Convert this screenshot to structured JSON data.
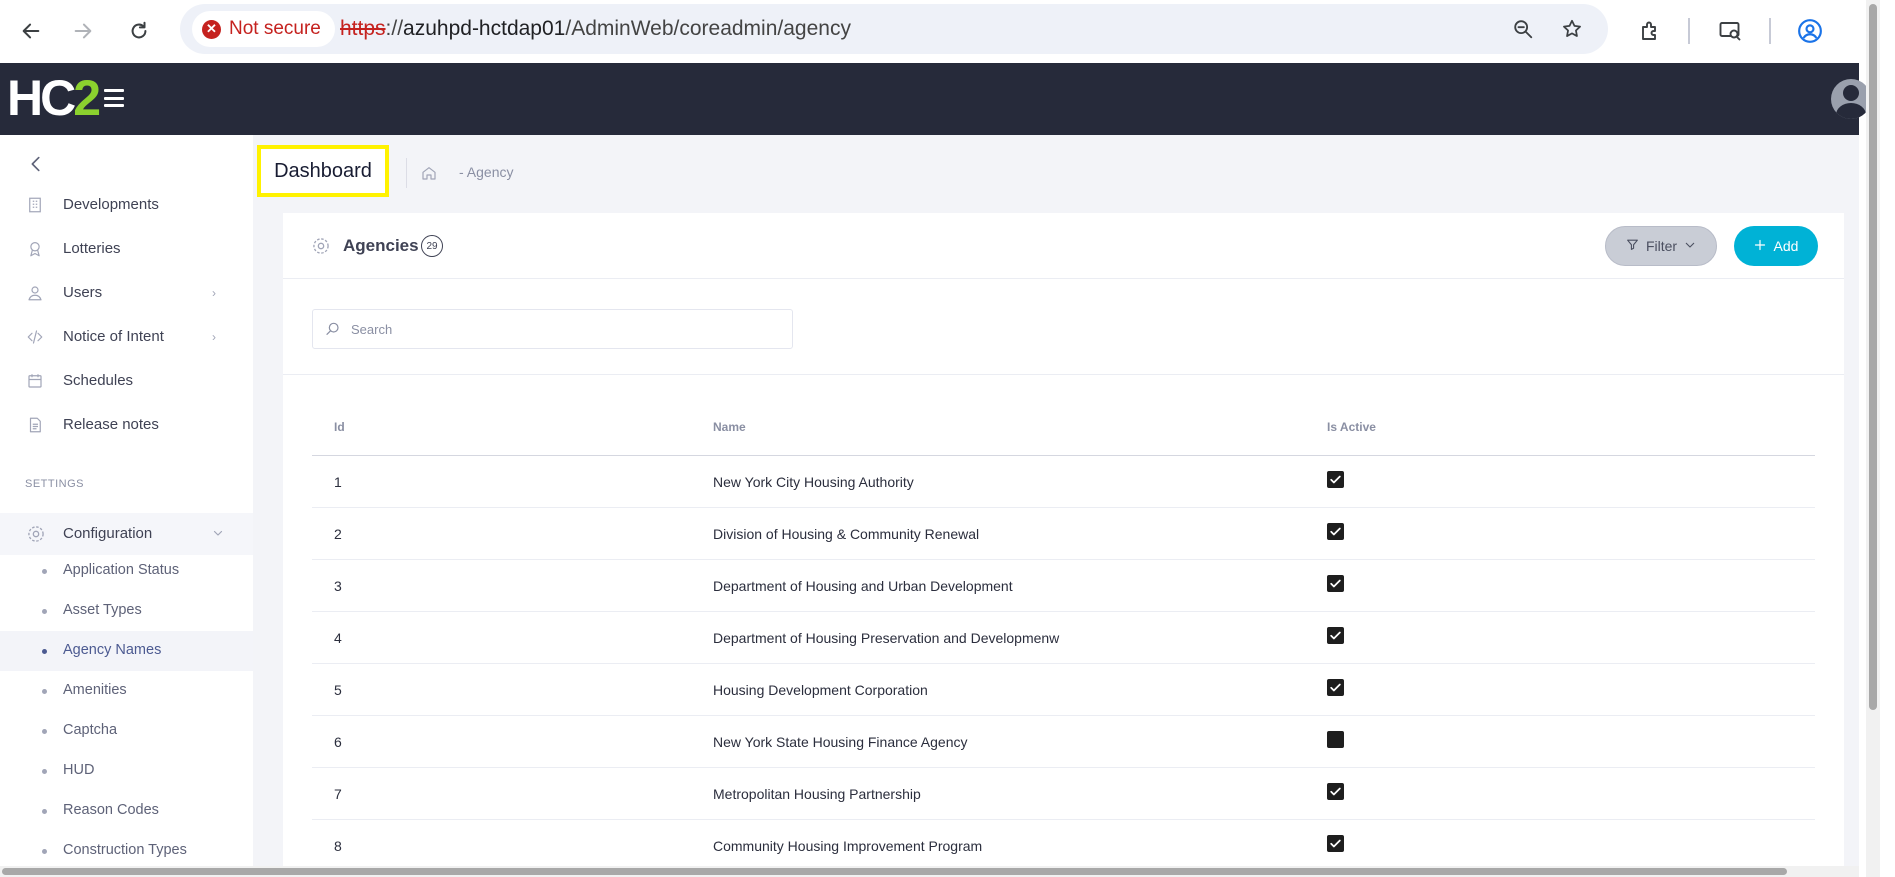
{
  "browser": {
    "security_label": "Not secure",
    "url_scheme": "https",
    "url_separator": "://",
    "url_host": "azuhpd-hctdap01",
    "url_path": "/AdminWeb/coreadmin/agency"
  },
  "app": {
    "logo_main": "HC",
    "logo_accent": "2",
    "accent_color": "#8bd12e",
    "header_color": "#262a3a"
  },
  "sidebar": {
    "items": [
      {
        "label": "Developments",
        "icon": "building-icon"
      },
      {
        "label": "Lotteries",
        "icon": "award-icon"
      },
      {
        "label": "Users",
        "icon": "user-icon",
        "has_children": true
      },
      {
        "label": "Notice of Intent",
        "icon": "code-icon",
        "has_children": true
      },
      {
        "label": "Schedules",
        "icon": "calendar-icon"
      },
      {
        "label": "Release notes",
        "icon": "document-icon"
      }
    ],
    "settings_label": "SETTINGS",
    "configuration_label": "Configuration",
    "sub_items": [
      {
        "label": "Application Status"
      },
      {
        "label": "Asset Types"
      },
      {
        "label": "Agency Names",
        "active": true
      },
      {
        "label": "Amenities"
      },
      {
        "label": "Captcha"
      },
      {
        "label": "HUD"
      },
      {
        "label": "Reason Codes"
      },
      {
        "label": "Construction Types"
      }
    ]
  },
  "page": {
    "title": "Dashboard",
    "breadcrumb": "- Agency"
  },
  "card": {
    "title": "Agencies",
    "count": "29",
    "filter_label": "Filter",
    "add_label": "Add",
    "add_color": "#00b2d6",
    "search_placeholder": "Search"
  },
  "table": {
    "headers": {
      "id": "Id",
      "name": "Name",
      "active": "Is Active"
    },
    "rows": [
      {
        "id": "1",
        "name": "New York City Housing Authority",
        "active": true
      },
      {
        "id": "2",
        "name": "Division of Housing & Community Renewal",
        "active": true
      },
      {
        "id": "3",
        "name": "Department of Housing and Urban Development",
        "active": true
      },
      {
        "id": "4",
        "name": "Department of Housing Preservation and Developmenw",
        "active": true
      },
      {
        "id": "5",
        "name": "Housing Development Corporation",
        "active": true
      },
      {
        "id": "6",
        "name": "New York State Housing Finance Agency",
        "active": false
      },
      {
        "id": "7",
        "name": "Metropolitan Housing Partnership",
        "active": true
      },
      {
        "id": "8",
        "name": "Community Housing Improvement Program",
        "active": true
      }
    ]
  }
}
